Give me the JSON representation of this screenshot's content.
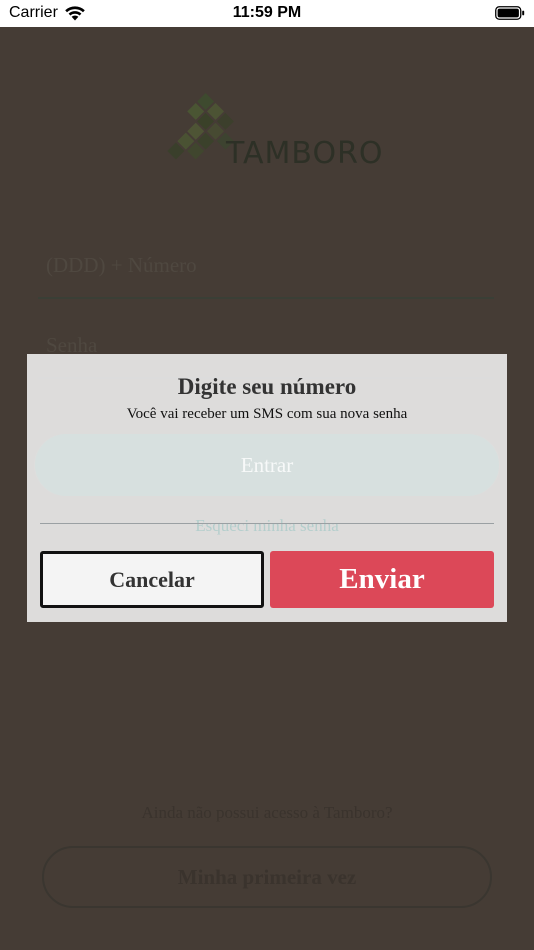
{
  "status_bar": {
    "carrier": "Carrier",
    "time": "11:59 PM",
    "icons": [
      "wifi-icon",
      "battery-icon"
    ]
  },
  "screen": {
    "logo_text": "TAMBORO",
    "phone_placeholder": "(DDD) + Número",
    "password_placeholder": "Senha",
    "login_button": "Entrar",
    "forgot_link": "Esqueci minha senha",
    "no_access_text": "Ainda não possui acesso à Tamboro?",
    "first_time_button": "Minha primeira vez"
  },
  "dialog": {
    "title": "Digite seu número",
    "message": "Você vai receber um SMS com sua nova senha",
    "input_value": "",
    "cancel_label": "Cancelar",
    "send_label": "Enviar"
  },
  "colors": {
    "overlay_background": "#453c35",
    "send_button": "#dc4858",
    "dialog_background": "#e8e8e8"
  }
}
